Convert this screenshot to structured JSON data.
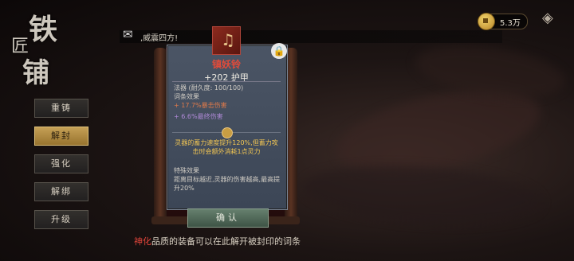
{
  "title": {
    "char1": "铁",
    "char2": "匠",
    "char3": "铺"
  },
  "notice": {
    "icon": "scroll-icon",
    "text": ",威震四方!"
  },
  "currency": {
    "icon": "coin-icon",
    "value": "5.3万"
  },
  "back": {
    "icon": "back-arrow-icon"
  },
  "menu": [
    {
      "label": "重铸",
      "active": false
    },
    {
      "label": "解封",
      "active": true
    },
    {
      "label": "强化",
      "active": false
    },
    {
      "label": "解绑",
      "active": false
    },
    {
      "label": "升级",
      "active": false
    }
  ],
  "item": {
    "icon": "bell-icon",
    "name": "镇妖铃",
    "armor": "+202 护甲",
    "type_line": "法器 (耐久度: 100/100)",
    "affix_header": "词条效果",
    "affix1": "+ 17.7%暴击伤害",
    "affix2": "+ 6.6%最终伤害",
    "sealed_effect": "灵器的蓄力速度提升120%,但蓄力攻击时会额外消耗1点灵力",
    "special_header": "特殊效果",
    "special_text": "距离目标越近,灵器的伤害越高,最高提升20%",
    "lock_icon": "lock-icon"
  },
  "confirm_label": "确认",
  "hint": {
    "highlight": "神化",
    "rest": "品质的装备可以在此解开被封印的词条"
  },
  "colors": {
    "accent_red": "#e24b3a",
    "gold": "#f2c653",
    "active_tab": "#c5a056"
  }
}
